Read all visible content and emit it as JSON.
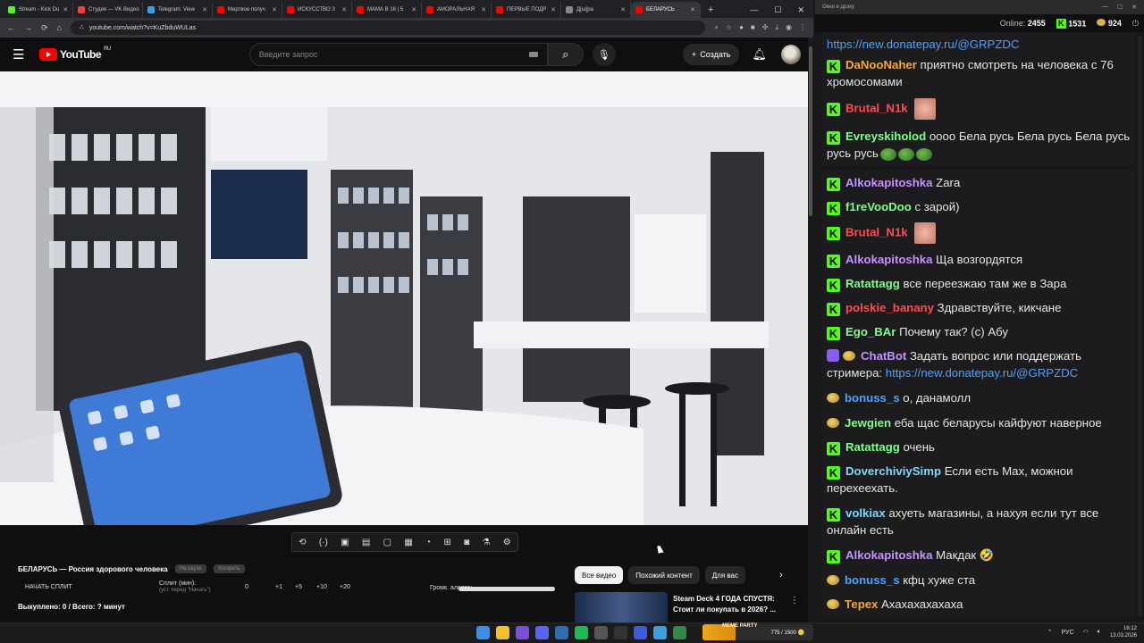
{
  "browser": {
    "tabs": [
      {
        "label": "Stream - Kick Du",
        "color": "#53fc18"
      },
      {
        "label": "Студия — VK Видео",
        "color": "#ff3b3b"
      },
      {
        "label": "Telegram: View",
        "color": "#3aa0e0"
      },
      {
        "label": "Мертвое получ",
        "color": "#ff0000"
      },
      {
        "label": "ИСКУССТВО З",
        "color": "#ff0000"
      },
      {
        "label": "МАМА В 16 | 5",
        "color": "#ff0000"
      },
      {
        "label": "АМОРАЛЬНАЯ",
        "color": "#ff0000"
      },
      {
        "label": "ПЕРВЫЕ ПОДР",
        "color": "#ff0000"
      },
      {
        "label": "Д[ш]ра",
        "color": "#888888"
      },
      {
        "label": "БЕЛАРУСЬ",
        "color": "#ff0000"
      }
    ],
    "new_tab": "+",
    "url": "youtube.com/watch?v=KuZbduWULas"
  },
  "youtube": {
    "logo": "YouTube",
    "logo_region": "RU",
    "search_placeholder": "Введите запрос",
    "create_label": "Создать",
    "create_icon": "+"
  },
  "player": {
    "title": "БЕЛАРУСЬ — Россия здорового человека",
    "chip_a": "На паузе",
    "chip_b": "Ускорить",
    "start_split": "НАЧАТЬ СПЛИТ",
    "split_label": "Сплит (мин):",
    "split_hint": "(уст. перед \"Начать\")",
    "split_values": [
      "0",
      "+1",
      "+5",
      "+10",
      "+20"
    ],
    "alert_label": "Громк. алерта:",
    "alert_volume": 1.0,
    "bought": "Выкуплено: 0 / Всего: ? минут"
  },
  "recommend": {
    "chips": [
      "Все видео",
      "Похожий контент",
      "Для вас"
    ],
    "next_icon": "chevron-right",
    "video_title": "Steam Deck 4 ГОДА СПУСТЯ: Стоит ли покупать в 2026? ..."
  },
  "chat": {
    "window_title": "Окно в дрэку",
    "online_label": "Online:",
    "online_value": "2455",
    "followers": "1531",
    "coins": "924",
    "messages": [
      {
        "user": "",
        "color": "#4aa3ff",
        "text": "https://new.donatepay.ru/@GRPZDC",
        "badge": "none",
        "link": true
      },
      {
        "user": "DaNooNaher",
        "color": "#f3a93a",
        "text": "приятно смотреть на человека с 76 хромосомами",
        "badge": "k"
      },
      {
        "user": "Brutal_N1k",
        "color": "#ff4d4d",
        "text": "",
        "badge": "k",
        "emote": true
      },
      {
        "user": "Evreyskiholod",
        "color": "#7cff8a",
        "text": "оооо Бела русь Бела русь Бела русь русь русь",
        "badge": "k",
        "peepo": true
      },
      {
        "user": "Alkokapitoshka",
        "color": "#c891ff",
        "text": "Zara",
        "badge": "k"
      },
      {
        "user": "f1reVooDoo",
        "color": "#7cff8a",
        "text": "с зарой)",
        "badge": "k"
      },
      {
        "user": "Brutal_N1k",
        "color": "#ff4d4d",
        "text": "",
        "badge": "k",
        "emote": true
      },
      {
        "user": "Alkokapitoshka",
        "color": "#c891ff",
        "text": "Ща возгордятся",
        "badge": "k"
      },
      {
        "user": "Ratattagg",
        "color": "#7cff8a",
        "text": "все переезжаю там же в Зара",
        "badge": "k"
      },
      {
        "user": "polskie_banany",
        "color": "#ff4d4d",
        "text": "Здравствуйте, кикчане",
        "badge": "k"
      },
      {
        "user": "Ego_BAr",
        "color": "#7cff8a",
        "text": "Почему так? (с) Абу",
        "badge": "k"
      },
      {
        "user": "ChatBot",
        "color": "#c891ff",
        "text": "Задать вопрос или поддержать стримера:",
        "badge": "bot",
        "link_text": "https://new.donatepay.ru/@GRPZDC"
      },
      {
        "user": "bonuss_s",
        "color": "#4aa3ff",
        "text": "о, данамолл",
        "badge": "coin"
      },
      {
        "user": "Jewgien",
        "color": "#7cff8a",
        "text": "еба щас беларусы кайфуют наверное",
        "badge": "coin"
      },
      {
        "user": "Ratattagg",
        "color": "#7cff8a",
        "text": "очень",
        "badge": "k"
      },
      {
        "user": "DoverchiviySimp",
        "color": "#7cd9ff",
        "text": "Если есть Max, можнои перехеехать.",
        "badge": "k"
      },
      {
        "user": "volkiax",
        "color": "#7cd9ff",
        "text": "ахуеть магазины, а нахуя если тут все онлайн есть",
        "badge": "k"
      },
      {
        "user": "Alkokapitoshka",
        "color": "#c891ff",
        "text": "Макдак 🤣",
        "badge": "k"
      },
      {
        "user": "bonuss_s",
        "color": "#4aa3ff",
        "text": "кфц хуже ста",
        "badge": "coin"
      },
      {
        "user": "Терех",
        "color": "#f3a93a",
        "text": "Ахахахахахаха",
        "badge": "coin"
      }
    ]
  },
  "taskbar": {
    "meme_party": "MEME PARTY",
    "meme_counter": "775 / 1500 🪙",
    "lang": "РУС",
    "time": "16:12",
    "date": "13.03.2026"
  }
}
